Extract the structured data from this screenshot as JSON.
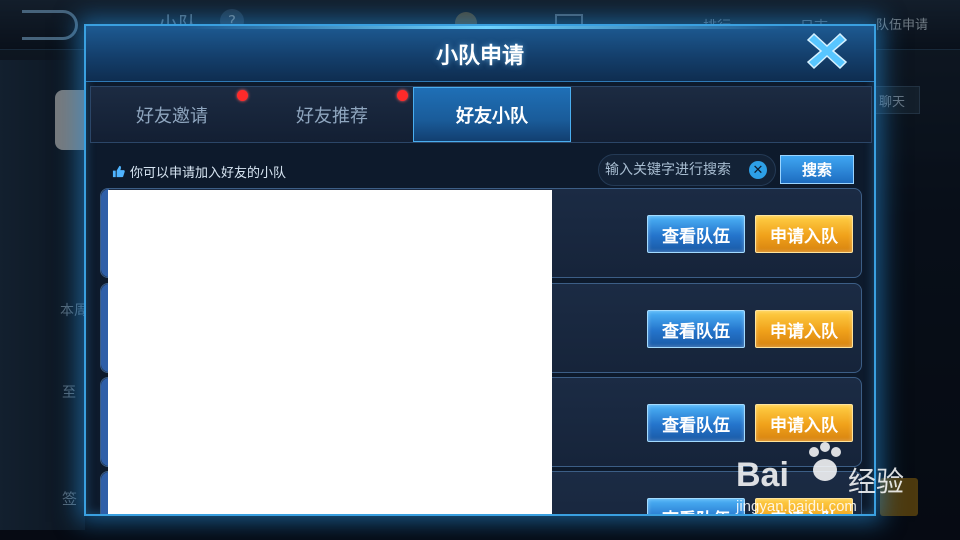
{
  "background": {
    "title": "小队",
    "help": "?",
    "tab_rank": "排行",
    "tab_log": "日志",
    "apply_label": "队伍申请",
    "chat_label": "聊天",
    "left_text_1": "本周",
    "left_text_2": "至",
    "left_text_3": "签"
  },
  "dialog": {
    "title": "小队申请",
    "tabs": [
      {
        "label": "好友邀请",
        "active": false,
        "badge": true
      },
      {
        "label": "好友推荐",
        "active": false,
        "badge": true
      },
      {
        "label": "好友小队",
        "active": true,
        "badge": false
      }
    ],
    "hint": "你可以申请加入好友的小队",
    "search": {
      "placeholder": "输入关键字进行搜索",
      "button": "搜索"
    },
    "rows": [
      {
        "view_label": "查看队伍",
        "join_label": "申请入队"
      },
      {
        "view_label": "查看队伍",
        "join_label": "申请入队"
      },
      {
        "view_label": "查看队伍",
        "join_label": "申请入队"
      },
      {
        "view_label": "查看队伍",
        "join_label": "申请入队"
      }
    ]
  },
  "watermark": {
    "logo": "Bai",
    "logo2": "经验",
    "url": "jingyan.baidu.com"
  },
  "colors": {
    "accent": "#3aa0e0",
    "join": "#f0a11a",
    "view": "#2474cb",
    "badge": "#ff2a2a"
  }
}
